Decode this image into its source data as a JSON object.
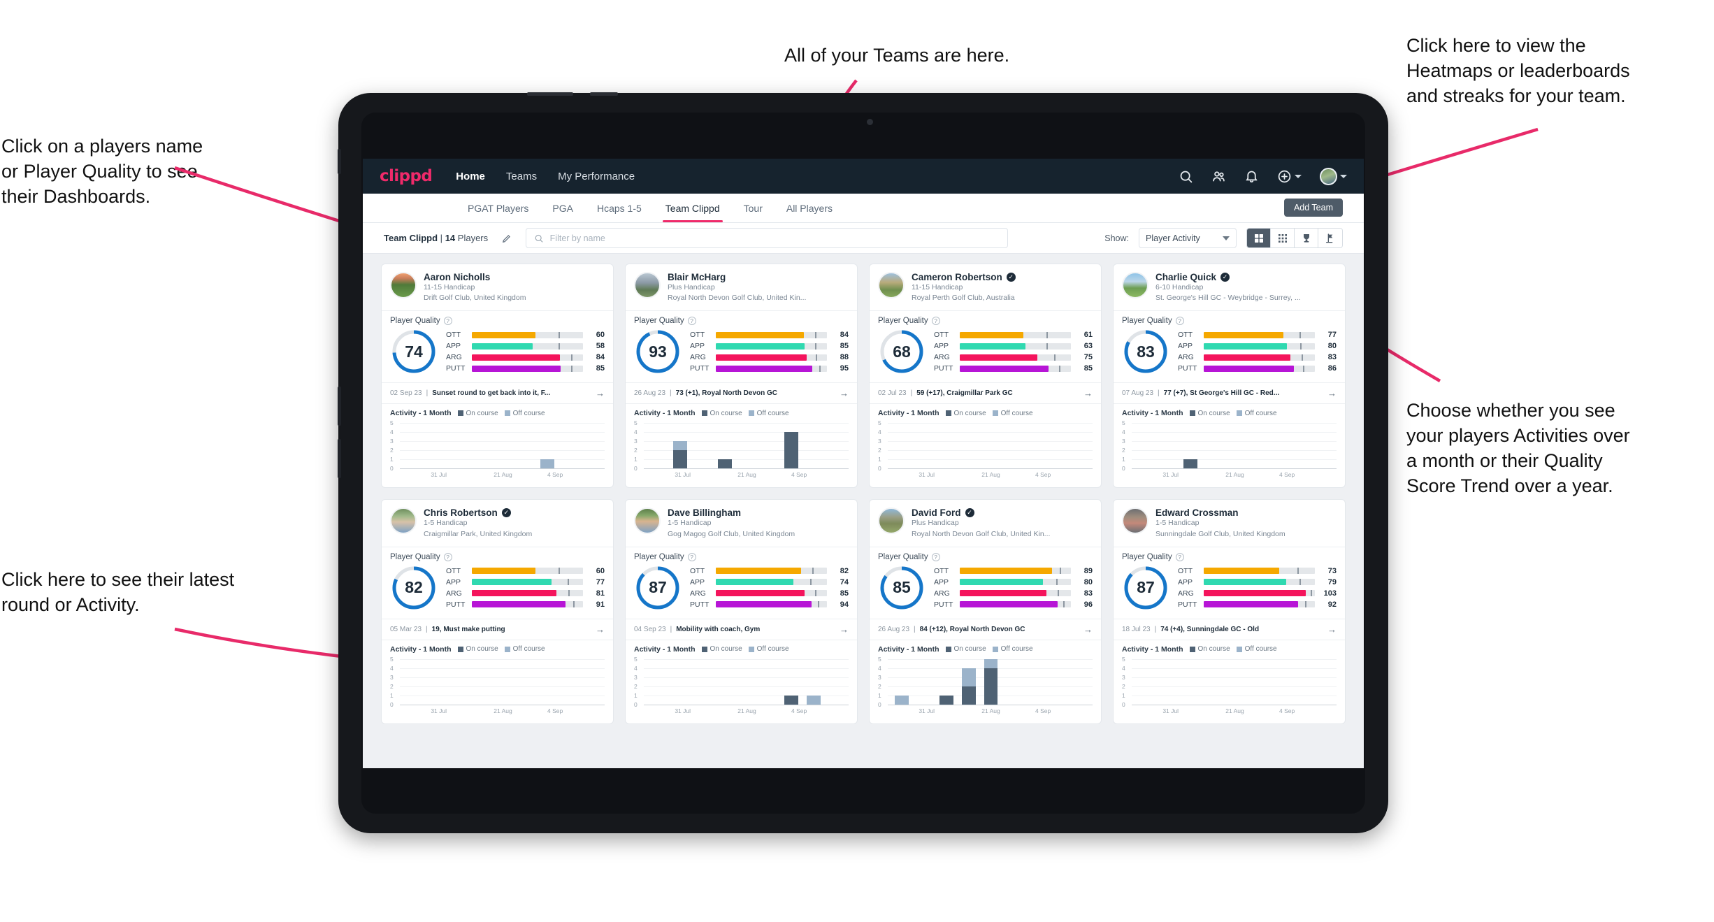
{
  "annotations": {
    "top_center": "All of your Teams are here.",
    "top_left": "Click on a players name\nor Player Quality to see\ntheir Dashboards.",
    "top_right": "Click here to view the\nHeatmaps or leaderboards\nand streaks for your team.",
    "right": "Choose whether you see\nyour players Activities over\na month or their Quality\nScore Trend over a year.",
    "bottom_left": "Click here to see their latest\nround or Activity.",
    "arrow_color": "#e82a69"
  },
  "app": {
    "brand": "clippd",
    "nav": [
      {
        "label": "Home",
        "active": true
      },
      {
        "label": "Teams",
        "active": false
      },
      {
        "label": "My Performance",
        "active": false
      }
    ],
    "top_icons": [
      {
        "name": "search-icon"
      },
      {
        "name": "people-icon"
      },
      {
        "name": "bell-icon"
      },
      {
        "name": "plus-circle-icon"
      }
    ],
    "subnav": {
      "tabs": [
        {
          "label": "PGAT Players",
          "active": false
        },
        {
          "label": "PGA",
          "active": false
        },
        {
          "label": "Hcaps 1-5",
          "active": false
        },
        {
          "label": "Team Clippd",
          "active": true
        },
        {
          "label": "Tour",
          "active": false
        },
        {
          "label": "All Players",
          "active": false
        }
      ],
      "add_team_label": "Add Team"
    },
    "filterbar": {
      "team_name": "Team Clippd",
      "separator": "|",
      "player_count": "14",
      "players_word": "Players",
      "search_placeholder": "Filter by name",
      "search_value": "",
      "show_label": "Show:",
      "show_value": "Player Activity",
      "view_buttons": [
        {
          "name": "grid-view-icon",
          "active": true
        },
        {
          "name": "table-view-icon",
          "active": false
        },
        {
          "name": "trophy-view-icon",
          "active": false
        },
        {
          "name": "golf-flag-view-icon",
          "active": false
        }
      ]
    }
  },
  "skill_colors": {
    "OTT": "#f5a800",
    "APP": "#2fd9b0",
    "ARG": "#f4145c",
    "PUTT": "#b715d6"
  },
  "chart_palette": {
    "on_course": "#4f6274",
    "off_course": "#9bb3ca"
  },
  "activity": {
    "title": "Activity - 1 Month",
    "legend_on": "On course",
    "legend_off": "Off course",
    "y_ticks": [
      "5",
      "4",
      "3",
      "2",
      "1",
      "0"
    ],
    "y_max": 5,
    "x_labels": [
      "31 Jul",
      "21 Aug",
      "4 Sep"
    ]
  },
  "cards": [
    {
      "name": "Aaron Nicholls",
      "verified": false,
      "handicap": "11-15 Handicap",
      "club": "Drift Golf Club, United Kingdom",
      "quality_label": "Player Quality",
      "quality": 74,
      "avatar_css": "linear-gradient(180deg,#f0a070 0%,#c87d5a 22%,#4f7a3a 48%,#6a9b4a 100%)",
      "skills": [
        {
          "name": "OTT",
          "value": 60,
          "fill_pct": 57,
          "tick_pct": 78
        },
        {
          "name": "APP",
          "value": 58,
          "fill_pct": 55,
          "tick_pct": 78
        },
        {
          "name": "ARG",
          "value": 84,
          "fill_pct": 79,
          "tick_pct": 89
        },
        {
          "name": "PUTT",
          "value": 85,
          "fill_pct": 80,
          "tick_pct": 89
        }
      ],
      "latest_date": "02 Sep 23",
      "latest_title": "Sunset round to get back into it, F...",
      "chart_data": {
        "type": "bar",
        "title": "Activity - 1 Month",
        "series": [
          {
            "name": "On course",
            "values": [
              0,
              0,
              0,
              0,
              0,
              0,
              0,
              0,
              0
            ]
          },
          {
            "name": "Off course",
            "values": [
              0,
              0,
              0,
              0,
              0,
              0,
              1,
              0,
              0
            ]
          }
        ]
      }
    },
    {
      "name": "Blair McHarg",
      "verified": false,
      "handicap": "Plus Handicap",
      "club": "Royal North Devon Golf Club, United Kin...",
      "quality_label": "Player Quality",
      "quality": 93,
      "avatar_css": "linear-gradient(180deg,#b9c7d2 0%,#8c9aa6 40%,#5f7a55 70%,#7e9667 100%)",
      "skills": [
        {
          "name": "OTT",
          "value": 84,
          "fill_pct": 79,
          "tick_pct": 89
        },
        {
          "name": "APP",
          "value": 85,
          "fill_pct": 80,
          "tick_pct": 89
        },
        {
          "name": "ARG",
          "value": 88,
          "fill_pct": 82,
          "tick_pct": 90
        },
        {
          "name": "PUTT",
          "value": 95,
          "fill_pct": 87,
          "tick_pct": 93
        }
      ],
      "latest_date": "26 Aug 23",
      "latest_title": "73 (+1), Royal North Devon GC",
      "chart_data": {
        "type": "bar",
        "title": "Activity - 1 Month",
        "series": [
          {
            "name": "On course",
            "values": [
              0,
              2,
              0,
              1,
              0,
              0,
              4,
              0,
              0
            ]
          },
          {
            "name": "Off course",
            "values": [
              0,
              1,
              0,
              0,
              0,
              0,
              0,
              0,
              0
            ]
          }
        ]
      }
    },
    {
      "name": "Cameron Robertson",
      "verified": true,
      "handicap": "11-15 Handicap",
      "club": "Royal Perth Golf Club, Australia",
      "quality_label": "Player Quality",
      "quality": 68,
      "avatar_css": "linear-gradient(180deg,#9fc0dd 0%,#b9ab7c 38%,#6f8f4e 70%,#87a85c 100%)",
      "skills": [
        {
          "name": "OTT",
          "value": 61,
          "fill_pct": 57,
          "tick_pct": 78
        },
        {
          "name": "APP",
          "value": 63,
          "fill_pct": 59,
          "tick_pct": 78
        },
        {
          "name": "ARG",
          "value": 75,
          "fill_pct": 70,
          "tick_pct": 85
        },
        {
          "name": "PUTT",
          "value": 85,
          "fill_pct": 80,
          "tick_pct": 89
        }
      ],
      "latest_date": "02 Jul 23",
      "latest_title": "59 (+17), Craigmillar Park GC",
      "chart_data": {
        "type": "bar",
        "title": "Activity - 1 Month",
        "series": [
          {
            "name": "On course",
            "values": [
              0,
              0,
              0,
              0,
              0,
              0,
              0,
              0,
              0
            ]
          },
          {
            "name": "Off course",
            "values": [
              0,
              0,
              0,
              0,
              0,
              0,
              0,
              0,
              0
            ]
          }
        ]
      }
    },
    {
      "name": "Charlie Quick",
      "verified": true,
      "handicap": "6-10 Handicap",
      "club": "St. George's Hill GC - Weybridge - Surrey, ...",
      "quality_label": "Player Quality",
      "quality": 83,
      "avatar_css": "linear-gradient(180deg,#8fc4e8 0%,#bcd6e8 35%,#6d9e52 62%,#8cb862 100%)",
      "skills": [
        {
          "name": "OTT",
          "value": 77,
          "fill_pct": 72,
          "tick_pct": 86
        },
        {
          "name": "APP",
          "value": 80,
          "fill_pct": 75,
          "tick_pct": 87
        },
        {
          "name": "ARG",
          "value": 83,
          "fill_pct": 78,
          "tick_pct": 88
        },
        {
          "name": "PUTT",
          "value": 86,
          "fill_pct": 81,
          "tick_pct": 89
        }
      ],
      "latest_date": "07 Aug 23",
      "latest_title": "77 (+7), St George's Hill GC - Red...",
      "chart_data": {
        "type": "bar",
        "title": "Activity - 1 Month",
        "series": [
          {
            "name": "On course",
            "values": [
              0,
              0,
              1,
              0,
              0,
              0,
              0,
              0,
              0
            ]
          },
          {
            "name": "Off course",
            "values": [
              0,
              0,
              0,
              0,
              0,
              0,
              0,
              0,
              0
            ]
          }
        ]
      }
    },
    {
      "name": "Chris Robertson",
      "verified": true,
      "handicap": "1-5 Handicap",
      "club": "Craigmillar Park, United Kingdom",
      "quality_label": "Player Quality",
      "quality": 82,
      "avatar_css": "linear-gradient(180deg,#6f8f5e 0%,#9fb98a 30%,#d8c2a8 55%,#7fa2c4 100%)",
      "skills": [
        {
          "name": "OTT",
          "value": 60,
          "fill_pct": 57,
          "tick_pct": 78
        },
        {
          "name": "APP",
          "value": 77,
          "fill_pct": 72,
          "tick_pct": 86
        },
        {
          "name": "ARG",
          "value": 81,
          "fill_pct": 76,
          "tick_pct": 87
        },
        {
          "name": "PUTT",
          "value": 91,
          "fill_pct": 84,
          "tick_pct": 91
        }
      ],
      "latest_date": "05 Mar 23",
      "latest_title": "19, Must make putting",
      "chart_data": {
        "type": "bar",
        "title": "Activity - 1 Month",
        "series": [
          {
            "name": "On course",
            "values": [
              0,
              0,
              0,
              0,
              0,
              0,
              0,
              0,
              0
            ]
          },
          {
            "name": "Off course",
            "values": [
              0,
              0,
              0,
              0,
              0,
              0,
              0,
              0,
              0
            ]
          }
        ]
      }
    },
    {
      "name": "Dave Billingham",
      "verified": false,
      "handicap": "1-5 Handicap",
      "club": "Gog Magog Golf Club, United Kingdom",
      "quality_label": "Player Quality",
      "quality": 87,
      "avatar_css": "linear-gradient(180deg,#5d7f4a 0%,#86a86a 28%,#d9b48f 52%,#7fa2c4 100%)",
      "skills": [
        {
          "name": "OTT",
          "value": 82,
          "fill_pct": 77,
          "tick_pct": 87
        },
        {
          "name": "APP",
          "value": 74,
          "fill_pct": 70,
          "tick_pct": 85
        },
        {
          "name": "ARG",
          "value": 85,
          "fill_pct": 80,
          "tick_pct": 89
        },
        {
          "name": "PUTT",
          "value": 94,
          "fill_pct": 86,
          "tick_pct": 92
        }
      ],
      "latest_date": "04 Sep 23",
      "latest_title": "Mobility with coach, Gym",
      "chart_data": {
        "type": "bar",
        "title": "Activity - 1 Month",
        "series": [
          {
            "name": "On course",
            "values": [
              0,
              0,
              0,
              0,
              0,
              0,
              1,
              0,
              0
            ]
          },
          {
            "name": "Off course",
            "values": [
              0,
              0,
              0,
              0,
              0,
              0,
              0,
              1,
              0
            ]
          }
        ]
      }
    },
    {
      "name": "David Ford",
      "verified": true,
      "handicap": "Plus Handicap",
      "club": "Royal North Devon Golf Club, United Kin...",
      "quality_label": "Player Quality",
      "quality": 85,
      "avatar_css": "linear-gradient(180deg,#8fb8d8 0%,#9a9f86 35%,#7d8a5a 62%,#95a86b 100%)",
      "skills": [
        {
          "name": "OTT",
          "value": 89,
          "fill_pct": 83,
          "tick_pct": 90
        },
        {
          "name": "APP",
          "value": 80,
          "fill_pct": 75,
          "tick_pct": 87
        },
        {
          "name": "ARG",
          "value": 83,
          "fill_pct": 78,
          "tick_pct": 88
        },
        {
          "name": "PUTT",
          "value": 96,
          "fill_pct": 88,
          "tick_pct": 93
        }
      ],
      "latest_date": "26 Aug 23",
      "latest_title": "84 (+12), Royal North Devon GC",
      "chart_data": {
        "type": "bar",
        "title": "Activity - 1 Month",
        "series": [
          {
            "name": "On course",
            "values": [
              0,
              0,
              1,
              2,
              4,
              0,
              0,
              0,
              0
            ]
          },
          {
            "name": "Off course",
            "values": [
              1,
              0,
              0,
              2,
              1,
              0,
              0,
              0,
              0
            ]
          }
        ]
      }
    },
    {
      "name": "Edward Crossman",
      "verified": false,
      "handicap": "1-5 Handicap",
      "club": "Sunningdale Golf Club, United Kingdom",
      "quality_label": "Player Quality",
      "quality": 87,
      "avatar_css": "linear-gradient(180deg,#6d6f72 0%,#a08d7d 35%,#c4897a 60%,#6b6f74 100%)",
      "skills": [
        {
          "name": "OTT",
          "value": 73,
          "fill_pct": 68,
          "tick_pct": 84
        },
        {
          "name": "APP",
          "value": 79,
          "fill_pct": 74,
          "tick_pct": 86
        },
        {
          "name": "ARG",
          "value": 103,
          "fill_pct": 92,
          "tick_pct": 96
        },
        {
          "name": "PUTT",
          "value": 92,
          "fill_pct": 85,
          "tick_pct": 91
        }
      ],
      "latest_date": "18 Jul 23",
      "latest_title": "74 (+4), Sunningdale GC - Old",
      "chart_data": {
        "type": "bar",
        "title": "Activity - 1 Month",
        "series": [
          {
            "name": "On course",
            "values": [
              0,
              0,
              0,
              0,
              0,
              0,
              0,
              0,
              0
            ]
          },
          {
            "name": "Off course",
            "values": [
              0,
              0,
              0,
              0,
              0,
              0,
              0,
              0,
              0
            ]
          }
        ]
      }
    }
  ]
}
